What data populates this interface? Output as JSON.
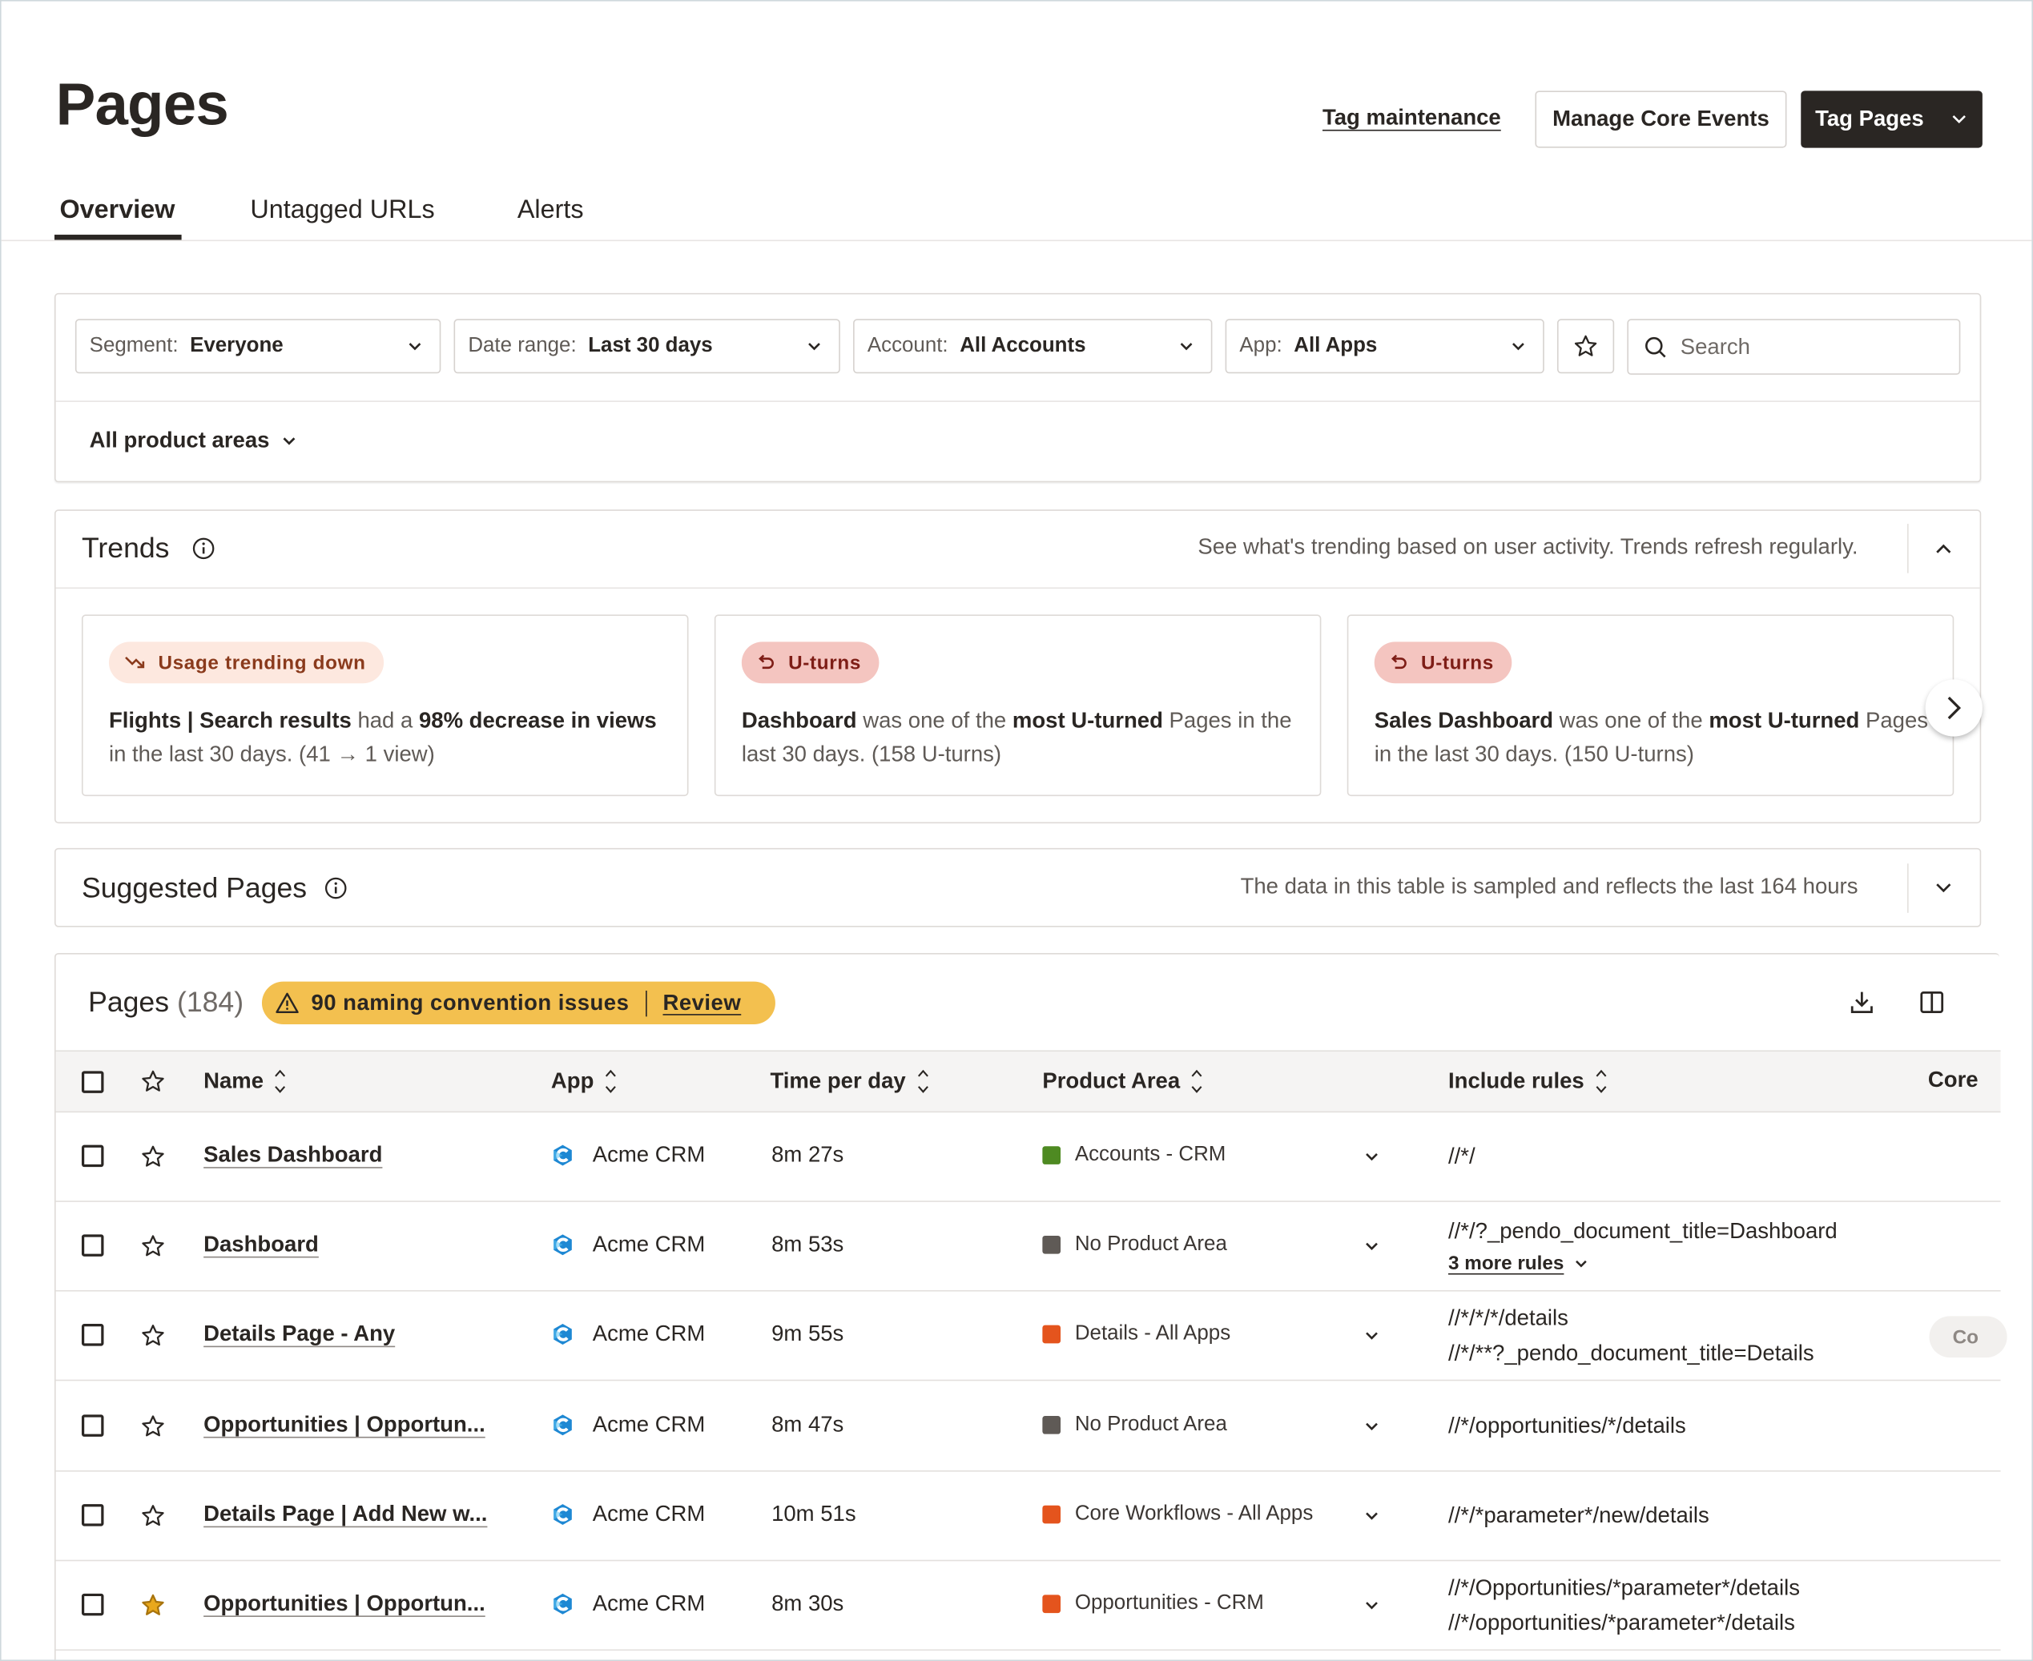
{
  "header": {
    "title": "Pages",
    "tag_maintenance": "Tag maintenance",
    "manage_core_events": "Manage Core Events",
    "tag_pages": "Tag Pages"
  },
  "tabs": [
    {
      "label": "Overview",
      "active": true
    },
    {
      "label": "Untagged URLs",
      "active": false
    },
    {
      "label": "Alerts",
      "active": false
    }
  ],
  "filters": {
    "segment": {
      "label": "Segment:",
      "value": "Everyone"
    },
    "date_range": {
      "label": "Date range:",
      "value": "Last 30 days"
    },
    "account": {
      "label": "Account:",
      "value": "All Accounts"
    },
    "app": {
      "label": "App:",
      "value": "All Apps"
    },
    "search_placeholder": "Search",
    "product_areas": "All product areas"
  },
  "trends": {
    "title": "Trends",
    "description": "See what's trending based on user activity. Trends refresh regularly.",
    "cards": [
      {
        "badge": "Usage trending down",
        "badge_type": "down",
        "subject": "Flights | Search results",
        "mid": " had a ",
        "emph": "98% decrease in views",
        "tail": " in the last 30 days. (41 → 1 view)"
      },
      {
        "badge": "U-turns",
        "badge_type": "uturn",
        "subject": "Dashboard",
        "mid": " was one of the ",
        "emph": "most U-turned",
        "tail": " Pages in the last 30 days. (158 U-turns)"
      },
      {
        "badge": "U-turns",
        "badge_type": "uturn",
        "subject": "Sales Dashboard",
        "mid": " was one of the ",
        "emph": "most U-turned",
        "tail": " Pages in the last 30 days. (150 U-turns)"
      }
    ]
  },
  "suggested": {
    "title": "Suggested Pages",
    "description": "The data in this table is sampled and reflects the last 164 hours"
  },
  "pages_table": {
    "title": "Pages",
    "count": "(184)",
    "naming_issues": "90 naming convention issues",
    "review": "Review",
    "columns": {
      "name": "Name",
      "app": "App",
      "time_per_day": "Time per day",
      "product_area": "Product Area",
      "include_rules": "Include rules",
      "core": "Core"
    },
    "core_pill": "Co",
    "colors": {
      "green": "#4e8a22",
      "gray": "#5f5a56",
      "orange": "#e4541d",
      "star_filled": "#e9a81c"
    },
    "rows": [
      {
        "name": "Sales Dashboard",
        "app": "Acme CRM",
        "time": "8m 27s",
        "area": "Accounts - CRM",
        "area_color": "#4e8a22",
        "rules": [
          "//*/"
        ],
        "more": "",
        "starred": false
      },
      {
        "name": "Dashboard",
        "app": "Acme CRM",
        "time": "8m 53s",
        "area": "No Product Area",
        "area_color": "#5f5a56",
        "rules": [
          "//*/?_pendo_document_title=Dashboard"
        ],
        "more": "3 more rules",
        "starred": false
      },
      {
        "name": "Details Page - Any",
        "app": "Acme CRM",
        "time": "9m 55s",
        "area": "Details - All Apps",
        "area_color": "#e4541d",
        "rules": [
          "//*/*/*/details",
          "//*/**?_pendo_document_title=Details"
        ],
        "more": "",
        "starred": false
      },
      {
        "name": "Opportunities | Opportun...",
        "app": "Acme CRM",
        "time": "8m 47s",
        "area": "No Product Area",
        "area_color": "#5f5a56",
        "rules": [
          "//*/opportunities/*/details"
        ],
        "more": "",
        "starred": false
      },
      {
        "name": "Details Page | Add New w...",
        "app": "Acme CRM",
        "time": "10m 51s",
        "area": "Core Workflows - All Apps",
        "area_color": "#e4541d",
        "rules": [
          "//*/*parameter*/new/details"
        ],
        "more": "",
        "starred": false
      },
      {
        "name": "Opportunities | Opportun...",
        "app": "Acme CRM",
        "time": "8m 30s",
        "area": "Opportunities - CRM",
        "area_color": "#e4541d",
        "rules": [
          "//*/Opportunities/*parameter*/details",
          "//*/opportunities/*parameter*/details"
        ],
        "more": "",
        "starred": true
      }
    ]
  }
}
